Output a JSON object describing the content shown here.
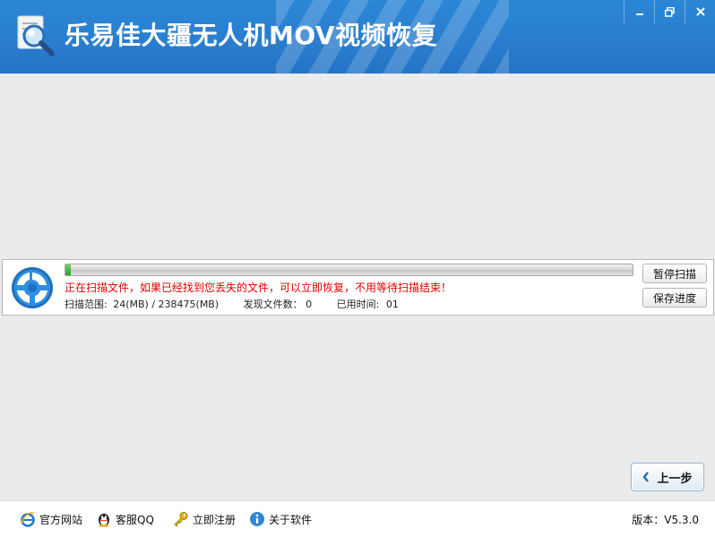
{
  "window": {
    "title": "乐易佳大疆无人机MOV视频恢复",
    "controls": [
      "minimize-icon",
      "restore-icon",
      "close-icon"
    ]
  },
  "scan": {
    "progress": 0.01,
    "message": "正在扫描文件，如果已经找到您丢失的文件，可以立即恢复，不用等待扫描结束！",
    "range_label": "扫描范围:",
    "range_value": "24(MB) / 238475(MB)",
    "found_label": "发现文件数：",
    "found_value": "0",
    "time_label": "已用时间:",
    "time_value": "01",
    "pause_button": "暂停扫描",
    "save_button": "保存进度"
  },
  "nav": {
    "back_button": "上一步"
  },
  "footer": {
    "links": [
      {
        "label": "官方网站",
        "icon": "ie-icon"
      },
      {
        "label": "客服QQ",
        "icon": "qq-penguin-icon"
      },
      {
        "label": "立即注册",
        "icon": "key-icon"
      },
      {
        "label": "关于软件",
        "icon": "info-icon"
      }
    ],
    "version_label": "版本：",
    "version_value": "V5.3.0"
  },
  "colors": {
    "titlebar": "#2a7ecf",
    "message": "#e00000",
    "background": "#ebebeb"
  }
}
